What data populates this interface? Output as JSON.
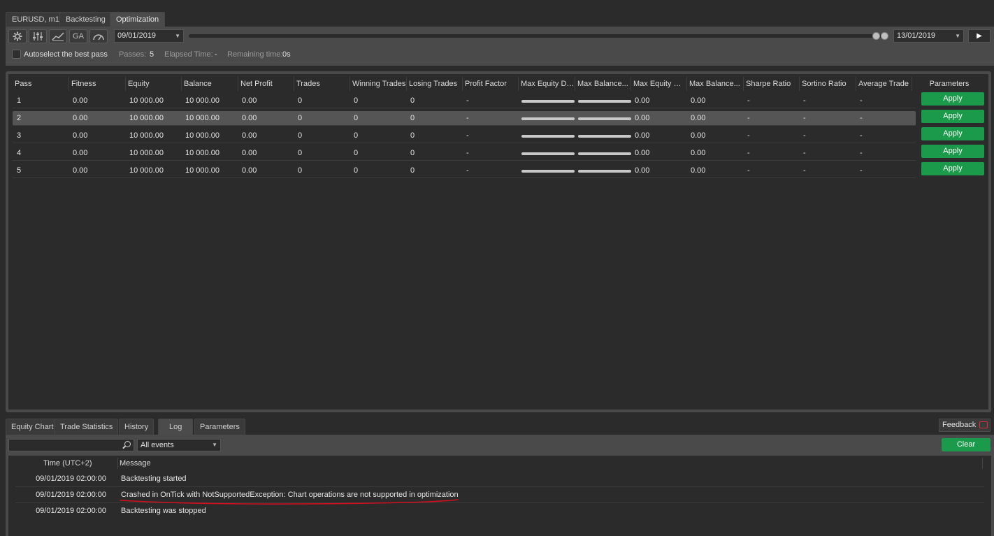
{
  "top_tabs": [
    "EURUSD, m1",
    "Backtesting",
    "Optimization"
  ],
  "toolbar": {
    "ga_label": "GA",
    "start_date": "09/01/2019",
    "end_date": "13/01/2019",
    "autoselect_label": "Autoselect the best pass",
    "passes_label": "Passes:",
    "passes_value": "5",
    "elapsed_label": "Elapsed Time:",
    "elapsed_value": "-",
    "remaining_label": "Remaining time:",
    "remaining_value": "0s"
  },
  "table": {
    "columns": [
      "Pass",
      "Fitness",
      "Equity",
      "Balance",
      "Net Profit",
      "Trades",
      "Winning Trades",
      "Losing Trades",
      "Profit Factor",
      "Max Equity Dr...",
      "Max Balance...",
      "Max Equity Dr...",
      "Max Balance...",
      "Sharpe Ratio",
      "Sortino Ratio",
      "Average Trade",
      "Parameters"
    ],
    "apply_label": "Apply",
    "rows": [
      {
        "pass": "1",
        "fitness": "0.00",
        "equity": "10 000.00",
        "balance": "10 000.00",
        "net_profit": "0.00",
        "trades": "0",
        "winning": "0",
        "losing": "0",
        "profit_factor": "-",
        "max_eq_pct": "0.00",
        "max_bal_pct": "0.00",
        "sharpe": "-",
        "sortino": "-",
        "avg_trade": "-"
      },
      {
        "pass": "2",
        "fitness": "0.00",
        "equity": "10 000.00",
        "balance": "10 000.00",
        "net_profit": "0.00",
        "trades": "0",
        "winning": "0",
        "losing": "0",
        "profit_factor": "-",
        "max_eq_pct": "0.00",
        "max_bal_pct": "0.00",
        "sharpe": "-",
        "sortino": "-",
        "avg_trade": "-"
      },
      {
        "pass": "3",
        "fitness": "0.00",
        "equity": "10 000.00",
        "balance": "10 000.00",
        "net_profit": "0.00",
        "trades": "0",
        "winning": "0",
        "losing": "0",
        "profit_factor": "-",
        "max_eq_pct": "0.00",
        "max_bal_pct": "0.00",
        "sharpe": "-",
        "sortino": "-",
        "avg_trade": "-"
      },
      {
        "pass": "4",
        "fitness": "0.00",
        "equity": "10 000.00",
        "balance": "10 000.00",
        "net_profit": "0.00",
        "trades": "0",
        "winning": "0",
        "losing": "0",
        "profit_factor": "-",
        "max_eq_pct": "0.00",
        "max_bal_pct": "0.00",
        "sharpe": "-",
        "sortino": "-",
        "avg_trade": "-"
      },
      {
        "pass": "5",
        "fitness": "0.00",
        "equity": "10 000.00",
        "balance": "10 000.00",
        "net_profit": "0.00",
        "trades": "0",
        "winning": "0",
        "losing": "0",
        "profit_factor": "-",
        "max_eq_pct": "0.00",
        "max_bal_pct": "0.00",
        "sharpe": "-",
        "sortino": "-",
        "avg_trade": "-"
      }
    ]
  },
  "bottom_tabs": [
    "Equity Chart",
    "Trade Statistics",
    "History",
    "Log",
    "Parameters"
  ],
  "feedback_label": "Feedback",
  "log": {
    "filter_value": "All events",
    "clear_label": "Clear",
    "time_header": "Time (UTC+2)",
    "message_header": "Message",
    "entries": [
      {
        "time": "09/01/2019 02:00:00",
        "message": "Backtesting started"
      },
      {
        "time": "09/01/2019 02:00:00",
        "message": "Crashed in OnTick with NotSupportedException: Chart operations are not supported in optimization"
      },
      {
        "time": "09/01/2019 02:00:00",
        "message": "Backtesting was stopped"
      }
    ]
  },
  "colors": {
    "accent_green": "#1a9a4a",
    "annotation_red": "#d0101e"
  }
}
